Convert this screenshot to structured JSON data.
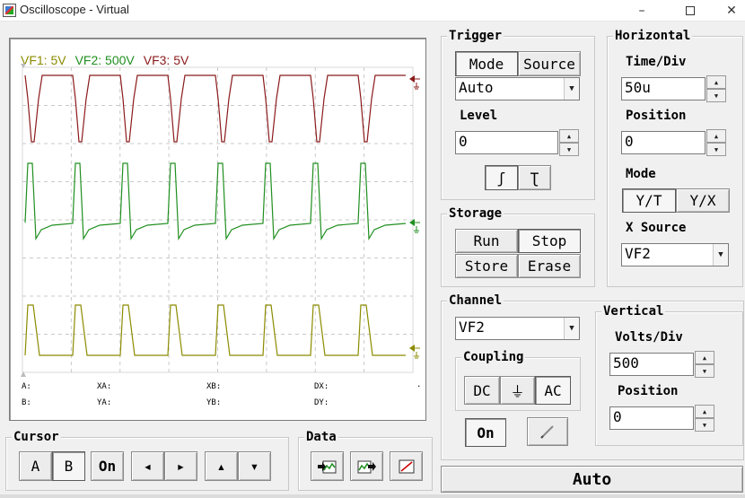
{
  "window": {
    "title": "Oscilloscope - Virtual",
    "min": "–",
    "close": "✕"
  },
  "legend": [
    {
      "text": "VF1: 5V",
      "color": "#8b8b00"
    },
    {
      "text": "VF2: 500V",
      "color": "#1f8f1f"
    },
    {
      "text": "VF3: 5V",
      "color": "#8b1a1a"
    }
  ],
  "cursor_readouts": [
    "A:",
    "XA:",
    "XB:",
    "DX:",
    "B:",
    "YA:",
    "YB:",
    "DY:",
    "."
  ],
  "trigger": {
    "title": "Trigger",
    "mode_label": "Mode",
    "source_label": "Source",
    "mode_value": "Auto",
    "level_label": "Level",
    "level_value": "0",
    "rising_edge": "ʃ",
    "falling_edge": "Ʈ"
  },
  "horizontal": {
    "title": "Horizontal",
    "time_div_label": "Time/Div",
    "time_div_value": "50u",
    "position_label": "Position",
    "position_value": "0",
    "mode_label": "Mode",
    "yt_label": "Y/T",
    "yx_label": "Y/X",
    "x_source_label": "X Source",
    "x_source_value": "VF2"
  },
  "storage": {
    "title": "Storage",
    "run": "Run",
    "stop": "Stop",
    "store": "Store",
    "erase": "Erase"
  },
  "channel": {
    "title": "Channel",
    "value": "VF2",
    "coupling_label": "Coupling",
    "dc": "DC",
    "gnd": "⏚",
    "ac": "AC",
    "on": "On"
  },
  "vertical": {
    "title": "Vertical",
    "volts_div_label": "Volts/Div",
    "volts_div_value": "500",
    "position_label": "Position",
    "position_value": "0"
  },
  "cursor": {
    "title": "Cursor",
    "a": "A",
    "b": "B",
    "on": "On"
  },
  "data_group": {
    "title": "Data"
  },
  "auto_button": "Auto",
  "colors": {
    "vf1": "#8b8b00",
    "vf2": "#1f8f1f",
    "vf3": "#8b1a1a",
    "grid": "#c9c9c9"
  },
  "icons": {
    "arrow_up": "▲",
    "arrow_down": "▼",
    "left": "◂",
    "right": "▸",
    "up2": "▴",
    "down2": "▾"
  }
}
